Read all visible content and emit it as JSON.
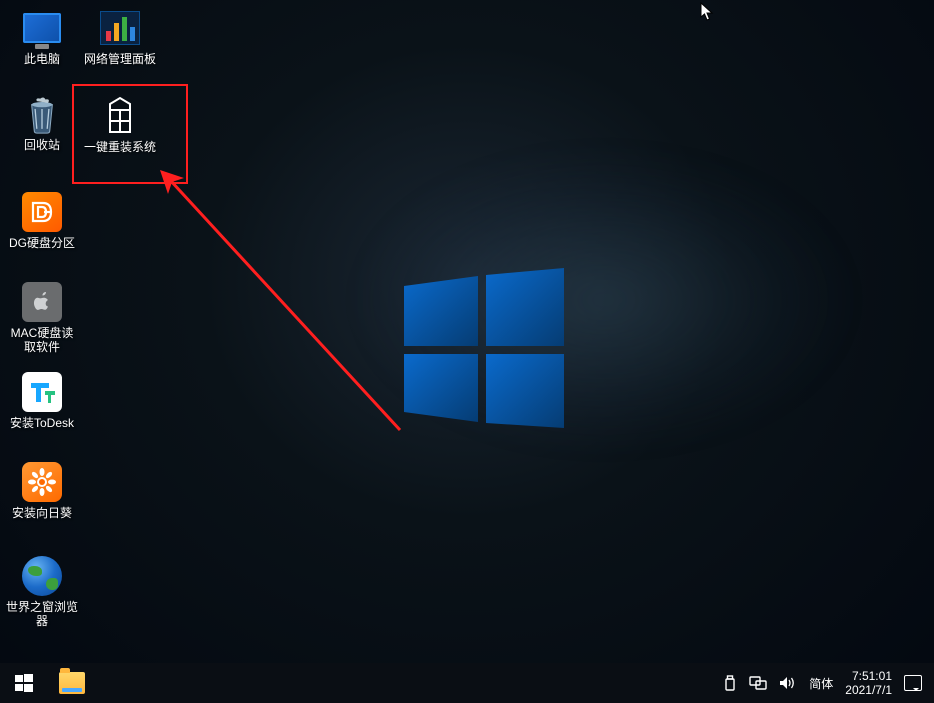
{
  "desktop": {
    "icons": {
      "computer": {
        "label": "此电脑"
      },
      "network_panel": {
        "label": "网络管理面板"
      },
      "recycle_bin": {
        "label": "回收站"
      },
      "reinstall": {
        "label": "一键重装系统"
      },
      "dg": {
        "label": "DG硬盘分区"
      },
      "mac": {
        "label": "MAC硬盘读取软件"
      },
      "todesk": {
        "label": "安装ToDesk"
      },
      "sunflower": {
        "label": "安装向日葵"
      },
      "browser": {
        "label": "世界之窗浏览器"
      }
    }
  },
  "taskbar": {
    "ime": "简体",
    "time": "7:51:01",
    "date": "2021/7/1"
  },
  "annotation": {
    "highlight_target": "reinstall",
    "highlight_color": "#ff1f1f"
  }
}
